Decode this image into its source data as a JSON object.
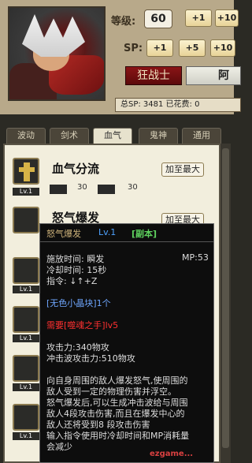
{
  "header": {
    "level_label": "等级:",
    "level_value": "60",
    "level_plus1": "+1",
    "level_plus10": "+10",
    "sp_label": "SP:",
    "sp_plus1": "+1",
    "sp_plus5": "+5",
    "sp_plus10": "+10",
    "class_name": "狂战士",
    "class_alt": "阿",
    "sp_summary": "总SP: 3481   已花费: 0"
  },
  "tabs": [
    "波动",
    "剑术",
    "血气",
    "鬼神",
    "通用"
  ],
  "active_tab": "血气",
  "skills": [
    {
      "name": "血气分流",
      "lv": "Lv.1",
      "stat1": "30",
      "stat2": "30",
      "max_label": "加至最大"
    },
    {
      "name": "怒气爆发",
      "lv": "Lv.1",
      "max_label": "加至最大"
    }
  ],
  "side_levels": [
    "Lv.1",
    "Lv.1",
    "Lv.1",
    "Lv.1",
    "Lv.1",
    "Lv.1"
  ],
  "tooltip": {
    "title": "怒气爆发",
    "level": "Lv.1",
    "tag": "[副本]",
    "cast": "施放时间: 瞬发",
    "mp": "MP:53",
    "cooldown": "冷却时间: 15秒",
    "command": "指令: ↓↑+Z",
    "material": "[无色小晶块]1个",
    "requirement": "需要[噬魂之手]lv5",
    "attack": "攻击力:340物攻",
    "shockwave": "冲击波攻击力:510物攻",
    "desc": [
      "向自身周围的敌人爆发怒气,使周围的",
      "敌人受到一定的物理伤害并浮空。",
      "怒气爆发后,可以生成冲击波给与周围",
      "敌人4段攻击伤害,而且在爆发中心的",
      "敌人还将受到8 段攻击伤害",
      "输入指令使用时冷却时间和MP消耗量",
      "会减少"
    ]
  },
  "watermark": "ezgame..."
}
